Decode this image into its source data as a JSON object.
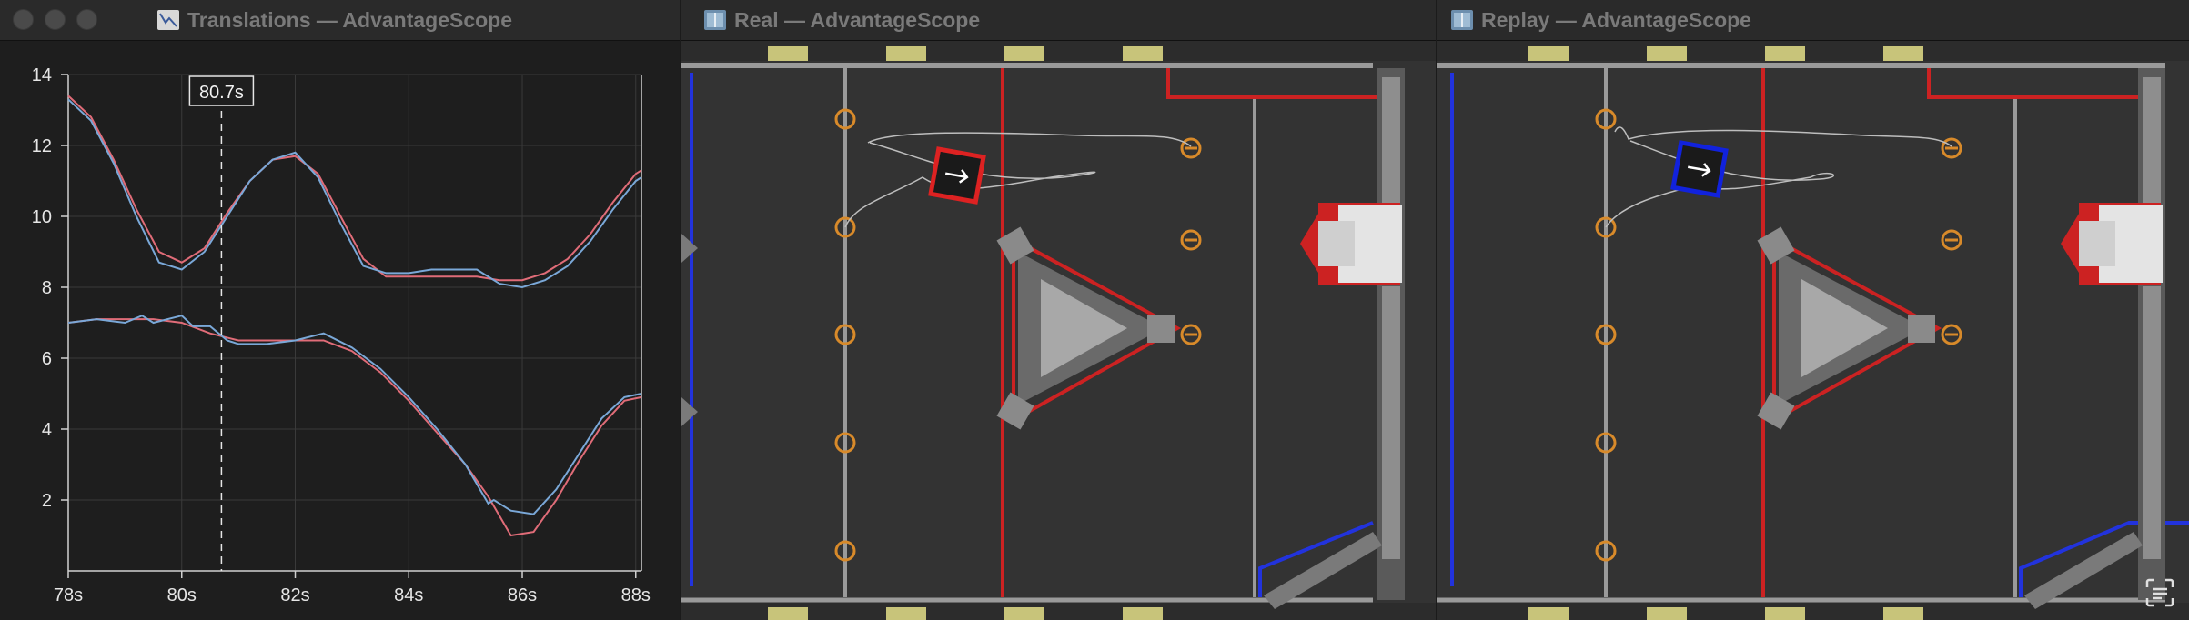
{
  "windows": [
    {
      "title": "Translations — AdvantageScope"
    },
    {
      "title": "Real — AdvantageScope"
    },
    {
      "title": "Replay — AdvantageScope"
    }
  ],
  "chart_data": {
    "type": "line",
    "cursor_label": "80.7s",
    "cursor_x": 80.7,
    "xlim": [
      78,
      88.1
    ],
    "ylim": [
      0,
      14
    ],
    "x_ticks": [
      "78s",
      "80s",
      "82s",
      "84s",
      "86s",
      "88s"
    ],
    "y_ticks": [
      "2",
      "4",
      "6",
      "8",
      "10",
      "12",
      "14"
    ],
    "grid": true,
    "series": [
      {
        "color": "#e06c78",
        "x": [
          78.0,
          78.4,
          78.8,
          79.2,
          79.6,
          80.0,
          80.4,
          80.8,
          81.2,
          81.6,
          82.0,
          82.4,
          82.8,
          83.2,
          83.6,
          84.0,
          84.4,
          84.8,
          85.2,
          85.6,
          86.0,
          86.4,
          86.8,
          87.2,
          87.6,
          88.0,
          88.1
        ],
        "y": [
          13.4,
          12.8,
          11.6,
          10.2,
          9.0,
          8.7,
          9.1,
          10.1,
          11.0,
          11.6,
          11.7,
          11.2,
          10.0,
          8.8,
          8.3,
          8.3,
          8.3,
          8.3,
          8.3,
          8.2,
          8.2,
          8.4,
          8.8,
          9.5,
          10.4,
          11.2,
          11.3
        ]
      },
      {
        "color": "#7aa8d8",
        "x": [
          78.0,
          78.4,
          78.8,
          79.2,
          79.6,
          80.0,
          80.4,
          80.8,
          81.2,
          81.6,
          82.0,
          82.4,
          82.8,
          83.2,
          83.6,
          84.0,
          84.4,
          84.8,
          85.2,
          85.6,
          86.0,
          86.4,
          86.8,
          87.2,
          87.6,
          88.0,
          88.1
        ],
        "y": [
          13.3,
          12.7,
          11.5,
          10.0,
          8.7,
          8.5,
          9.0,
          10.0,
          11.0,
          11.6,
          11.8,
          11.1,
          9.8,
          8.6,
          8.4,
          8.4,
          8.5,
          8.5,
          8.5,
          8.1,
          8.0,
          8.2,
          8.6,
          9.3,
          10.2,
          11.0,
          11.1
        ]
      },
      {
        "color": "#e06c78",
        "x": [
          78.0,
          78.5,
          79.0,
          79.5,
          80.0,
          80.5,
          81.0,
          81.5,
          82.0,
          82.5,
          83.0,
          83.5,
          84.0,
          84.5,
          85.0,
          85.4,
          85.8,
          86.2,
          86.6,
          87.0,
          87.4,
          87.8,
          88.1
        ],
        "y": [
          7.0,
          7.1,
          7.1,
          7.1,
          7.0,
          6.7,
          6.5,
          6.5,
          6.5,
          6.5,
          6.2,
          5.6,
          4.8,
          3.9,
          3.0,
          2.1,
          1.0,
          1.1,
          2.0,
          3.1,
          4.1,
          4.8,
          4.9
        ]
      },
      {
        "color": "#7aa8d8",
        "x": [
          78.0,
          78.5,
          79.0,
          79.3,
          79.5,
          80.0,
          80.2,
          80.5,
          80.8,
          81.0,
          81.5,
          82.0,
          82.5,
          83.0,
          83.5,
          84.0,
          84.5,
          85.0,
          85.4,
          85.5,
          85.8,
          86.2,
          86.6,
          87.0,
          87.4,
          87.8,
          88.1
        ],
        "y": [
          7.0,
          7.1,
          7.0,
          7.2,
          7.0,
          7.2,
          6.9,
          6.9,
          6.5,
          6.4,
          6.4,
          6.5,
          6.7,
          6.3,
          5.7,
          4.9,
          4.0,
          3.0,
          1.9,
          2.0,
          1.7,
          1.6,
          2.3,
          3.3,
          4.3,
          4.9,
          5.0
        ]
      }
    ]
  }
}
